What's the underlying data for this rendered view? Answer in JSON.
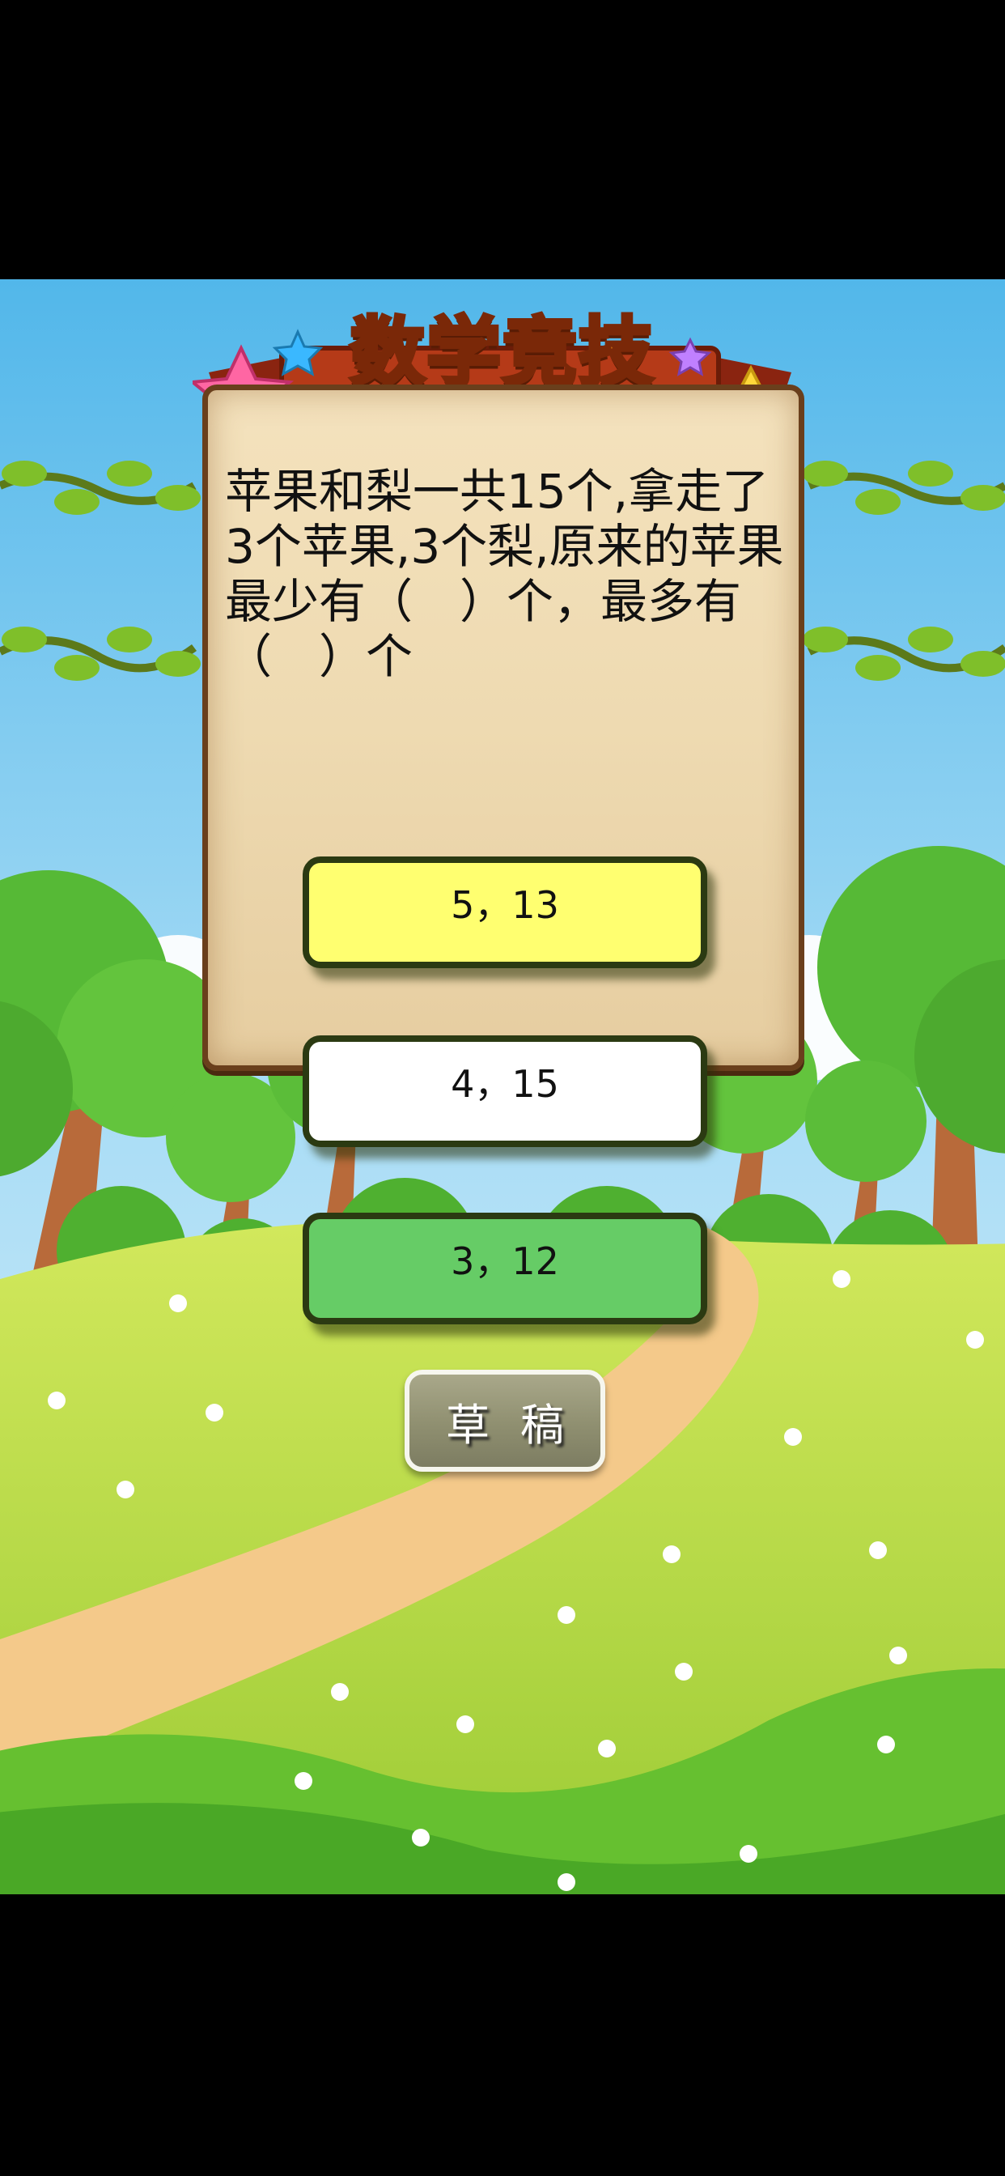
{
  "title": "数学竞技",
  "question": "苹果和梨一共15个,拿走了3个苹果,3个梨,原来的苹果最少有（　）个，最多有（　）个",
  "options": [
    {
      "label": "5，13",
      "color": "#ffff70"
    },
    {
      "label": "4，15",
      "color": "#ffffff"
    },
    {
      "label": "3，12",
      "color": "#66cc66"
    }
  ],
  "draft_button": "草稿",
  "colors": {
    "sky": "#9fd6f3",
    "grass": "#a8d645",
    "path": "#f4c98a",
    "board": "#f0dcb0"
  }
}
